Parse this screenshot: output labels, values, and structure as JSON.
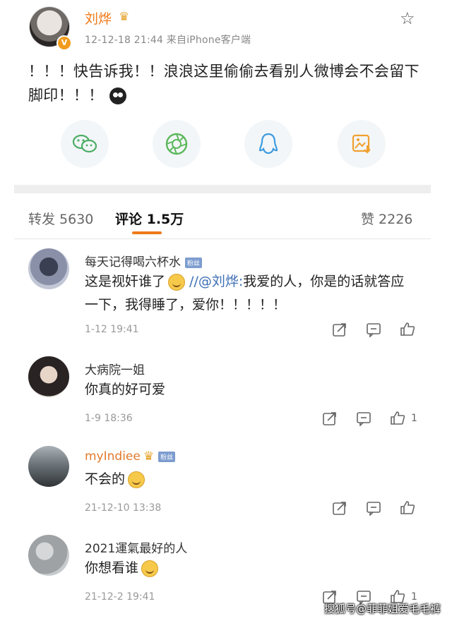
{
  "post": {
    "author": "刘烨",
    "meta": "12-12-18 21:44  来自iPhone客户端",
    "text": "！！！快告诉我！！浪浪这里偷偷去看别人微博会不会留下脚印！！！"
  },
  "share_icons": [
    "wechat-icon",
    "moments-icon",
    "qq-icon",
    "save-image-icon"
  ],
  "tabs": {
    "repost": "转发 5630",
    "comment": "评论 1.5万",
    "like": "赞 2226"
  },
  "comments": [
    {
      "name": "每天记得喝六杯水",
      "badge": "粉丝",
      "text_prefix": "这是视奸谁了",
      "mention": " //@刘烨:",
      "text_suffix": "我爱的人，你是的话就答应一下，我得睡了，爱你！！！！！",
      "time": "1-12 19:41",
      "likes": ""
    },
    {
      "name": "大病院一姐",
      "badge": "",
      "text": "你真的好可爱",
      "time": "1-9 18:36",
      "likes": "1"
    },
    {
      "name": "myIndiee",
      "badge": "粉丝",
      "text": "不会的",
      "time": "21-12-10 13:38",
      "likes": ""
    },
    {
      "name": "2021運氣最好的人",
      "badge": "",
      "text": "你想看谁",
      "time": "21-12-2 19:41",
      "likes": "1"
    }
  ],
  "watermark": "搜狐号@菲菲姐爱毛毛裤",
  "colors": {
    "accent": "#f07a18",
    "link": "#3d6fb6",
    "share_bg": "#f3f6f8"
  }
}
